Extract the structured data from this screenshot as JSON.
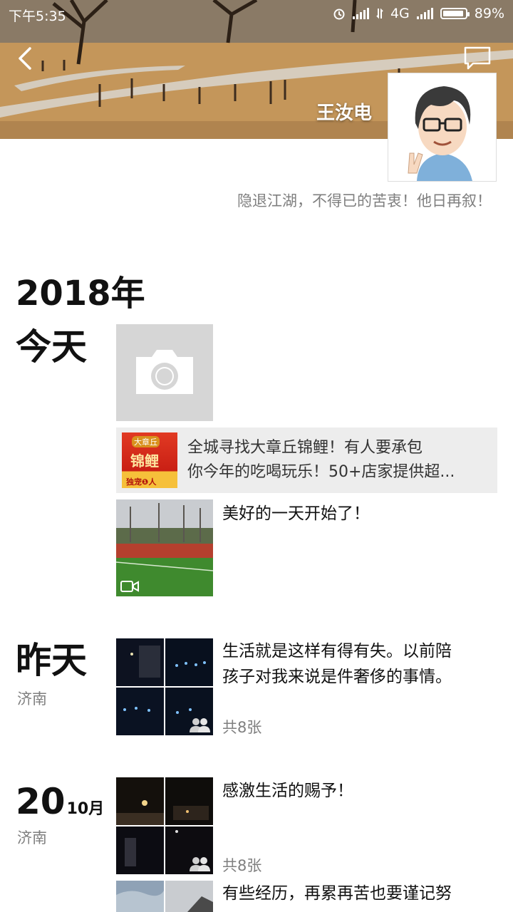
{
  "status_bar": {
    "time": "下午5:35",
    "network": "4G",
    "battery": "89%"
  },
  "profile": {
    "name": "王汝电",
    "signature": "隐退江湖，不得已的苦衷！他日再叙！"
  },
  "timeline": {
    "year": "2018年",
    "groups": [
      {
        "day_label": "今天",
        "share_card": {
          "line1": "全城寻找大章丘锦鲤！有人要承包",
          "line2": "你今年的吃喝玩乐！50+店家提供超...",
          "thumb_top": "大章丘",
          "thumb_mid": "锦鲤",
          "thumb_bottom": "独宠❶人"
        },
        "video_post_text": "美好的一天开始了！"
      },
      {
        "day_label": "昨天",
        "location": "济南",
        "text_line1": "生活就是这样有得有失。以前陪",
        "text_line2": "孩子对我来说是件奢侈的事情。",
        "photo_count": "共8张"
      },
      {
        "day_number": "20",
        "month": "10月",
        "location": "济南",
        "text": "感激生活的赐予！",
        "photo_count": "共8张",
        "next_text": "有些经历，再累再苦也要谨记努"
      }
    ]
  },
  "colors": {
    "accent_gray": "#7f7f7f",
    "camera_tile": "#d6d6d6",
    "share_card_bg": "#ededed"
  }
}
